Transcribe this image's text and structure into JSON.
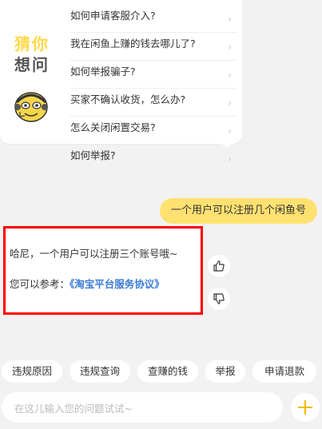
{
  "faq": {
    "title_line1": "猜你",
    "title_line2": "想问",
    "questions": [
      "如何申请客服介入?",
      "我在闲鱼上赚的钱去哪儿了?",
      "如何举报骗子?",
      "买家不确认收货，怎么办?",
      "怎么关闭闲置交易?",
      "如何举报?"
    ]
  },
  "user_message": "一个用户可以注册几个闲鱼号",
  "reply": {
    "line1": "哈尼，一个用户可以注册三个账号哦~",
    "line2_prefix": "您可以参考：",
    "link_text": "《淘宝平台服务协议》"
  },
  "chips": [
    "违规原因",
    "违规查询",
    "查赚的钱",
    "举报",
    "申请退款"
  ],
  "input": {
    "placeholder": "在这儿输入您的问题试试~",
    "value": ""
  },
  "colors": {
    "accent": "#ffe171",
    "link": "#3a7bd5",
    "plus": "#f5b800",
    "highlight": "#ff0000"
  },
  "icons": [
    "mascot-icon",
    "thumbs-up-icon",
    "thumbs-down-icon",
    "plus-icon",
    "chevron-right-icon"
  ]
}
